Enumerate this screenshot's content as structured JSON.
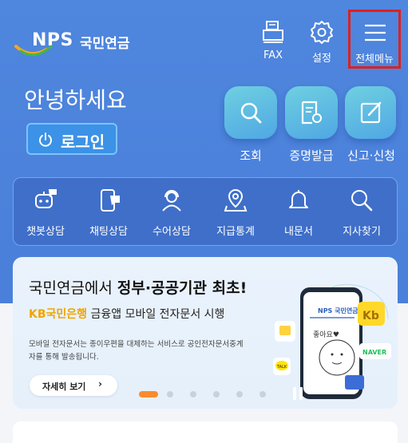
{
  "header": {
    "logo_text": "NPS",
    "logo_kr": "국민연금",
    "buttons": [
      {
        "label": "FAX",
        "icon": "fax-icon"
      },
      {
        "label": "설정",
        "icon": "gear-icon"
      },
      {
        "label": "전체메뉴",
        "icon": "hamburger-menu-icon"
      }
    ]
  },
  "greeting": "안녕하세요",
  "login_label": "로그인",
  "quick_actions": [
    {
      "label": "조회",
      "icon": "search-icon"
    },
    {
      "label": "증명발급",
      "icon": "certificate-icon"
    },
    {
      "label": "신고·신청",
      "icon": "edit-icon"
    }
  ],
  "services": [
    {
      "label": "챗봇상담",
      "icon": "chatbot-icon"
    },
    {
      "label": "채팅상담",
      "icon": "chat-phone-icon"
    },
    {
      "label": "수어상담",
      "icon": "headset-agent-icon"
    },
    {
      "label": "지급통계",
      "icon": "map-pin-icon"
    },
    {
      "label": "내문서",
      "icon": "bell-icon"
    },
    {
      "label": "지사찾기",
      "icon": "magnifier-icon"
    }
  ],
  "banner": {
    "title_plain": "국민연금에서 ",
    "title_bold": "정부·공공기관 최초!",
    "sub_kb": "KB국민은행",
    "sub_rest": " 금융앱 모바일 전자문서 시행",
    "desc": "모바일 전자문서는 종이우편을 대체하는 서비스로 공인전자문서중계자를 통해 발송됩니다.",
    "more_label": "자세히 보기",
    "phone_brand": "NPS 국민연금",
    "phone_text": "좋아요♥",
    "naver_label": "NAVER",
    "talk_label": "TALK",
    "slide_count": 6,
    "active_slide": 1
  },
  "colors": {
    "primary_bg": "#4a80d9",
    "menu_highlight": "#e0201c",
    "accent_orange": "#f98b2e",
    "kb_yellow": "#f0a400"
  }
}
